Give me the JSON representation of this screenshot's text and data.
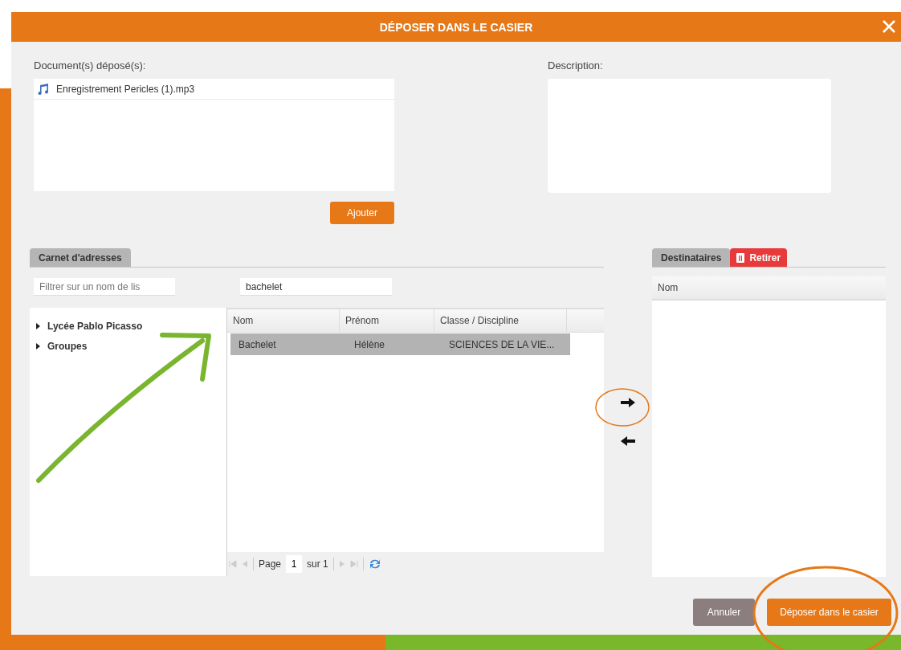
{
  "window": {
    "title": "DÉPOSER DANS LE CASIER"
  },
  "documents": {
    "label": "Document(s) déposé(s):",
    "files": [
      {
        "name": "Enregistrement Pericles (1).mp3"
      }
    ],
    "add_button": "Ajouter"
  },
  "description": {
    "label": "Description:"
  },
  "address_book": {
    "tabs": [
      {
        "label": "Carnet d'adresses",
        "selected": true
      }
    ],
    "list_filter": {
      "placeholder": "Filtrer sur un nom de lis"
    },
    "search": {
      "value": "bachelet"
    },
    "tree": [
      {
        "label": "Lycée Pablo Picasso",
        "expanded": false
      },
      {
        "label": "Groupes",
        "expanded": false
      }
    ],
    "table": {
      "columns": [
        "Nom",
        "Prénom",
        "Classe / Discipline"
      ],
      "rows": [
        {
          "cells": [
            "Bachelet",
            "Hélène",
            "SCIENCES DE LA VIE..."
          ],
          "selected": true
        }
      ]
    },
    "pager": {
      "page_label": "Page",
      "page": "1",
      "total": "sur 1"
    }
  },
  "recipients": {
    "tabs": [
      {
        "label": "Destinataires",
        "kind": "tab"
      },
      {
        "label": "Retirer",
        "kind": "remove"
      }
    ],
    "columns": [
      "Nom"
    ]
  },
  "buttons": [
    {
      "label": "Annuler",
      "kind": "cancel"
    },
    {
      "label": "Déposer dans le casier",
      "kind": "primary"
    }
  ]
}
